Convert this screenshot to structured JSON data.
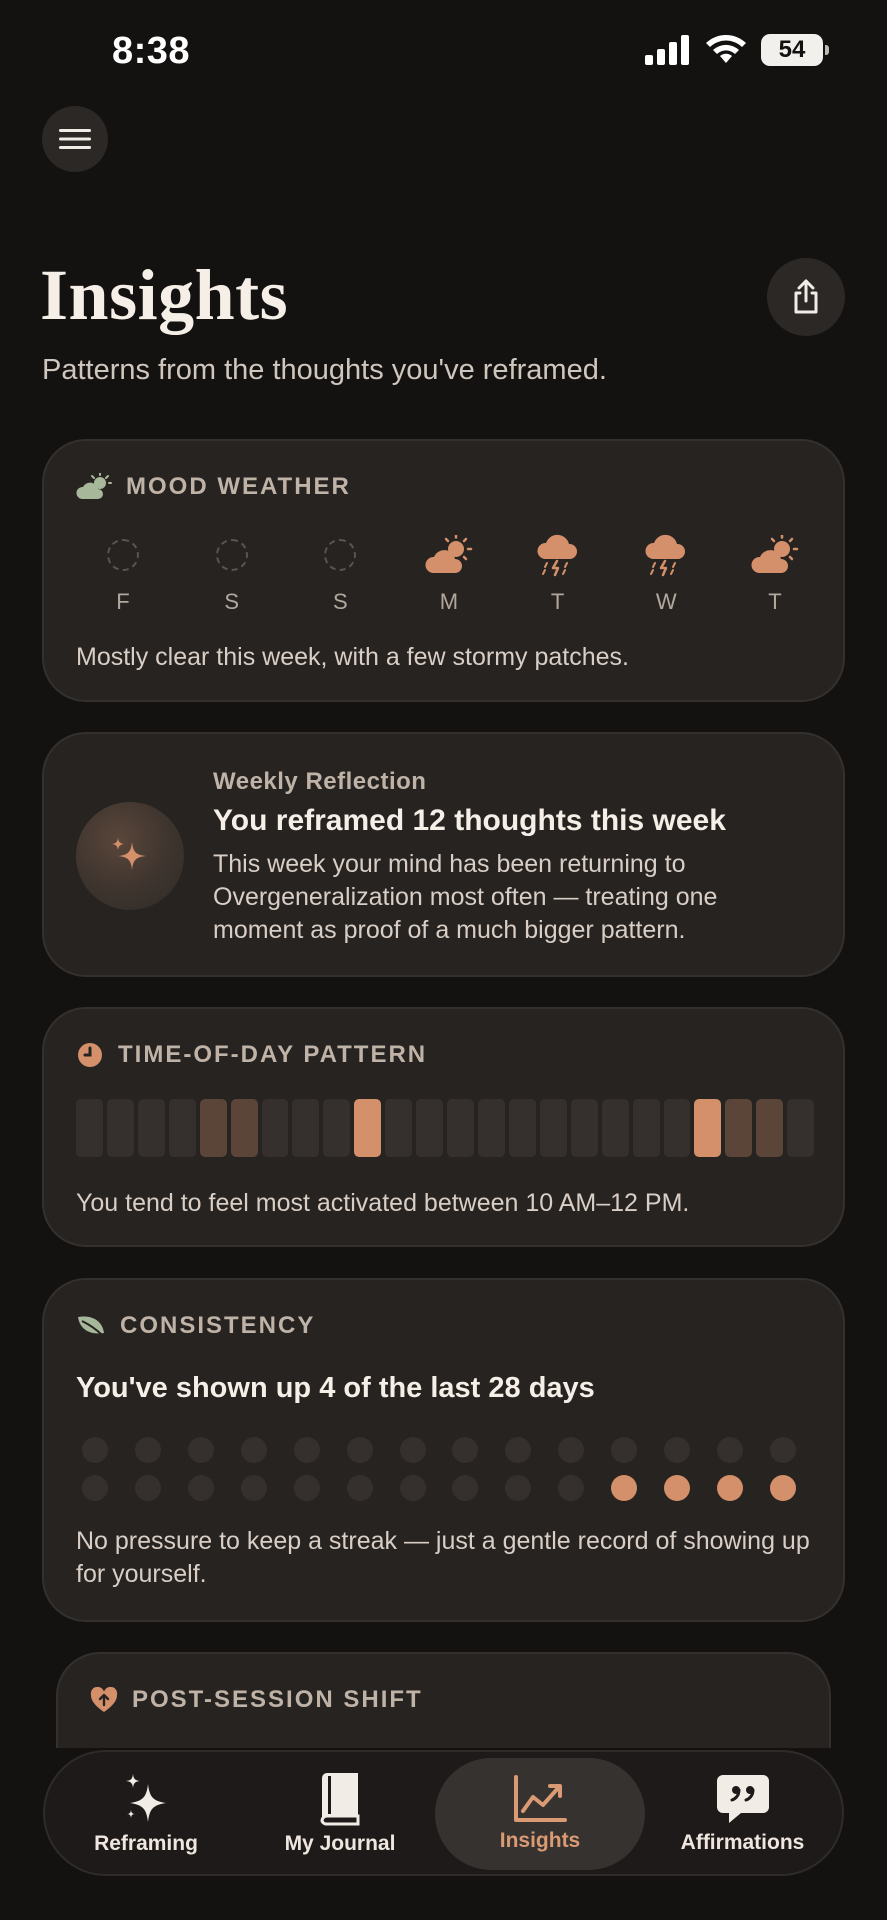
{
  "status": {
    "time": "8:38",
    "battery": "54"
  },
  "header": {
    "title": "Insights",
    "subtitle": "Patterns from the thoughts you've reframed."
  },
  "mood_weather": {
    "label": "MOOD WEATHER",
    "days": [
      {
        "day": "F",
        "weather": "none"
      },
      {
        "day": "S",
        "weather": "none"
      },
      {
        "day": "S",
        "weather": "none"
      },
      {
        "day": "M",
        "weather": "partly-sunny"
      },
      {
        "day": "T",
        "weather": "thunderstorm"
      },
      {
        "day": "W",
        "weather": "thunderstorm"
      },
      {
        "day": "T",
        "weather": "partly-sunny"
      }
    ],
    "summary": "Mostly clear this week, with a few stormy patches."
  },
  "reflection": {
    "eyebrow": "Weekly Reflection",
    "title": "You reframed 12 thoughts this week",
    "body": "This week your mind has been returning to Overgeneralization most often — treating one moment as proof of a much bigger pattern."
  },
  "time_of_day": {
    "label": "TIME-OF-DAY PATTERN",
    "levels": [
      0,
      0,
      0,
      0,
      1,
      1,
      0,
      0,
      0,
      2,
      0,
      0,
      0,
      0,
      0,
      0,
      0,
      0,
      0,
      0,
      2,
      1,
      1,
      0
    ],
    "summary": "You tend to feel most activated between 10 AM–12 PM."
  },
  "consistency": {
    "label": "CONSISTENCY",
    "title": "You've shown up 4 of the last 28 days",
    "days_active": [
      0,
      0,
      0,
      0,
      0,
      0,
      0,
      0,
      0,
      0,
      0,
      0,
      0,
      0,
      0,
      0,
      0,
      0,
      0,
      0,
      0,
      0,
      0,
      0,
      1,
      1,
      1,
      1
    ],
    "note": "No pressure to keep a streak — just a gentle record of showing up for yourself."
  },
  "post_session": {
    "label": "POST-SESSION SHIFT"
  },
  "tabs": [
    {
      "label": "Reframing",
      "icon": "sparkles-icon"
    },
    {
      "label": "My Journal",
      "icon": "book-icon"
    },
    {
      "label": "Insights",
      "icon": "chart-icon"
    },
    {
      "label": "Affirmations",
      "icon": "quote-bubble-icon"
    }
  ],
  "colors": {
    "accent": "#d4906a",
    "card": "#272321",
    "background": "#141211",
    "leaf_green": "#a7b79a"
  }
}
